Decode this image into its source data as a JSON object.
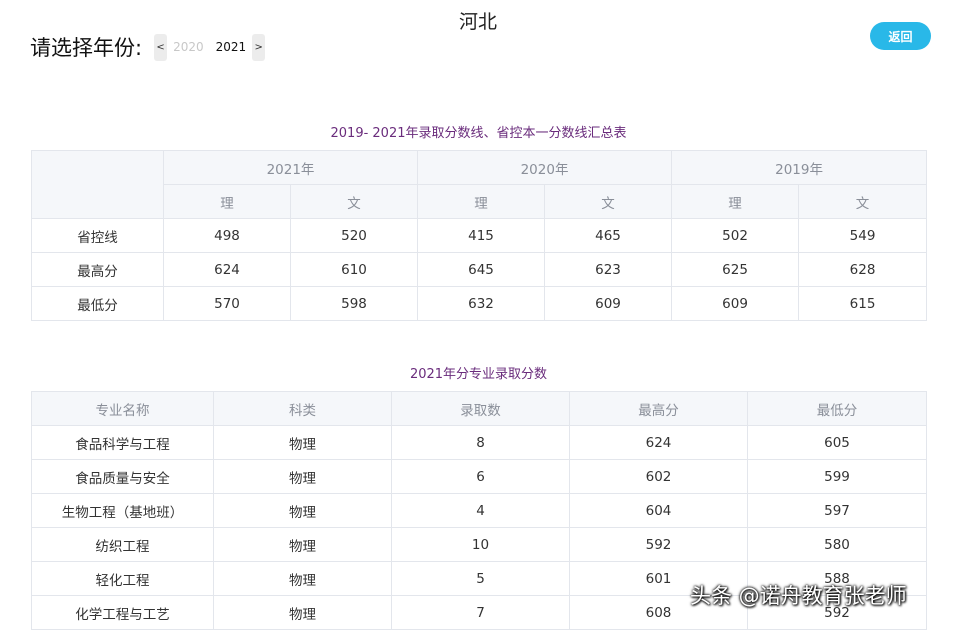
{
  "page": {
    "title": "河北",
    "back_label": "返回"
  },
  "year_picker": {
    "label": "请选择年份:",
    "prev": "<",
    "next": ">",
    "years": [
      "2020",
      "2021"
    ],
    "selected": "2021"
  },
  "summary": {
    "caption": "2019- 2021年录取分数线、省控本一分数线汇总表",
    "years": [
      "2021年",
      "2020年",
      "2019年"
    ],
    "subjects": [
      "理",
      "文",
      "理",
      "文",
      "理",
      "文"
    ],
    "rows": [
      {
        "label": "省控线",
        "values": [
          "498",
          "520",
          "415",
          "465",
          "502",
          "549"
        ]
      },
      {
        "label": "最高分",
        "values": [
          "624",
          "610",
          "645",
          "623",
          "625",
          "628"
        ]
      },
      {
        "label": "最低分",
        "values": [
          "570",
          "598",
          "632",
          "609",
          "609",
          "615"
        ]
      }
    ]
  },
  "majors": {
    "caption": "2021年分专业录取分数",
    "headers": [
      "专业名称",
      "科类",
      "录取数",
      "最高分",
      "最低分"
    ],
    "rows": [
      [
        "食品科学与工程",
        "物理",
        "8",
        "624",
        "605"
      ],
      [
        "食品质量与安全",
        "物理",
        "6",
        "602",
        "599"
      ],
      [
        "生物工程（基地班）",
        "物理",
        "4",
        "604",
        "597"
      ],
      [
        "纺织工程",
        "物理",
        "10",
        "592",
        "580"
      ],
      [
        "轻化工程",
        "物理",
        "5",
        "601",
        "588"
      ],
      [
        "化学工程与工艺",
        "物理",
        "7",
        "608",
        "592"
      ]
    ]
  },
  "watermark": "头条 @诺舟教育张老师"
}
